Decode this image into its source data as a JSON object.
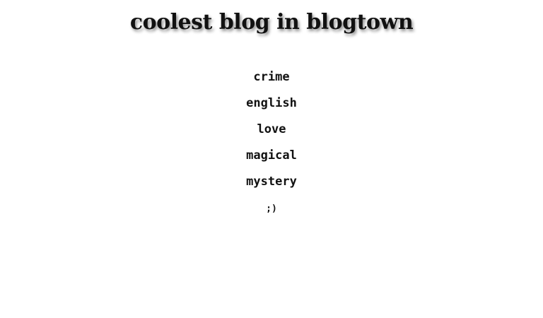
{
  "header": {
    "title": "coolest blog in blogtown"
  },
  "nav": {
    "items": [
      {
        "label": "crime"
      },
      {
        "label": "english"
      },
      {
        "label": "love"
      },
      {
        "label": "magical"
      },
      {
        "label": "mystery"
      },
      {
        "label": ";)"
      }
    ]
  }
}
